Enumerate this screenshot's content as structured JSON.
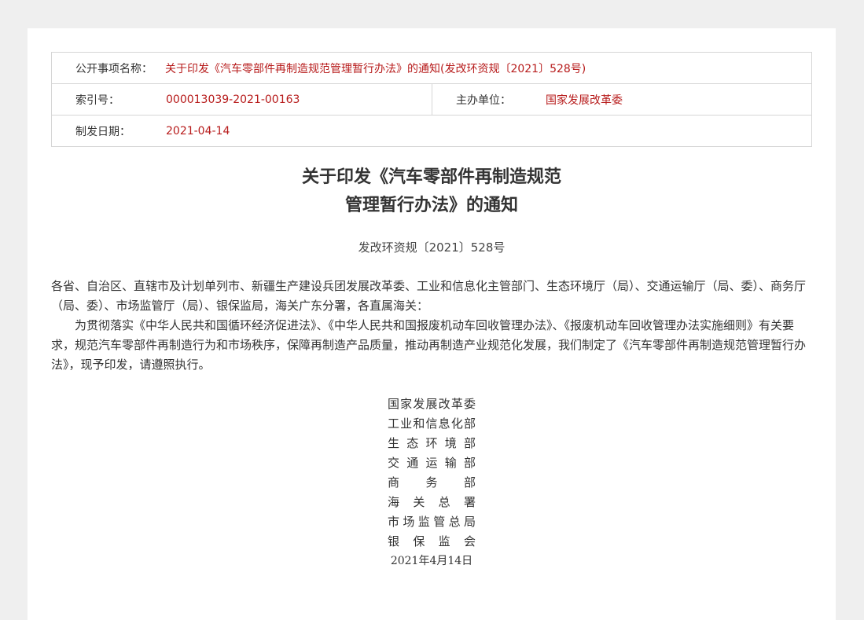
{
  "meta": {
    "subject_label": "公开事项名称：",
    "subject_value": "关于印发《汽车零部件再制造规范管理暂行办法》的通知(发改环资规〔2021〕528号)",
    "index_label": "索引号：",
    "index_value": "000013039-2021-00163",
    "issuer_label": "主办单位：",
    "issuer_value": "国家发展改革委",
    "date_label": "制发日期：",
    "date_value": "2021-04-14"
  },
  "document": {
    "title_line1": "关于印发《汽车零部件再制造规范",
    "title_line2": "管理暂行办法》的通知",
    "doc_number": "发改环资规〔2021〕528号",
    "addressee": "各省、自治区、直辖市及计划单列市、新疆生产建设兵团发展改革委、工业和信息化主管部门、生态环境厅（局）、交通运输厅（局、委）、商务厅（局、委）、市场监管厅（局）、银保监局，海关广东分署，各直属海关：",
    "paragraph": "为贯彻落实《中华人民共和国循环经济促进法》、《中华人民共和国报废机动车回收管理办法》、《报废机动车回收管理办法实施细则》有关要求，规范汽车零部件再制造行为和市场秩序，保障再制造产品质量，推动再制造产业规范化发展，我们制定了《汽车零部件再制造规范管理暂行办法》，现予印发，请遵照执行。",
    "signers": [
      "国家发展改革委",
      "工业和信息化部",
      "生态环境部",
      "交通运输部",
      "商务部",
      "海关总署",
      "市场监管总局",
      "银保监会"
    ],
    "sign_date": "2021年4月14日"
  }
}
